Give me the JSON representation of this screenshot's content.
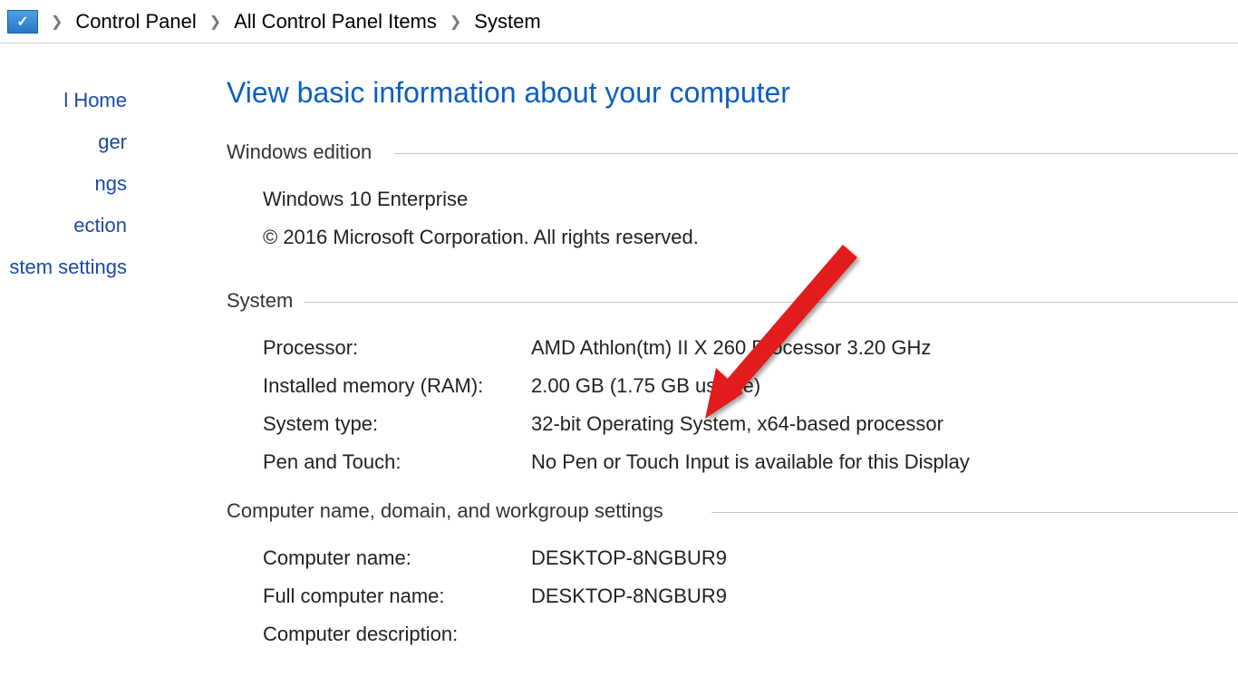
{
  "breadcrumb": {
    "items": [
      "Control Panel",
      "All Control Panel Items",
      "System"
    ]
  },
  "sidebar": {
    "items": [
      "l Home",
      "ger",
      "ngs",
      "ection",
      "stem settings"
    ]
  },
  "page": {
    "title": "View basic information about your computer"
  },
  "windows_edition": {
    "header": "Windows edition",
    "name": "Windows 10 Enterprise",
    "copyright": "© 2016 Microsoft Corporation. All rights reserved."
  },
  "system": {
    "header": "System",
    "rows": [
      {
        "label": "Processor:",
        "value": "AMD Athlon(tm) II X 260 Processor   3.20 GHz"
      },
      {
        "label": "Installed memory (RAM):",
        "value": "2.00 GB (1.75 GB usable)"
      },
      {
        "label": "System type:",
        "value": "32-bit Operating System, x64-based processor"
      },
      {
        "label": "Pen and Touch:",
        "value": "No Pen or Touch Input is available for this Display"
      }
    ]
  },
  "computer_name": {
    "header": "Computer name, domain, and workgroup settings",
    "rows": [
      {
        "label": "Computer name:",
        "value": "DESKTOP-8NGBUR9"
      },
      {
        "label": "Full computer name:",
        "value": "DESKTOP-8NGBUR9"
      },
      {
        "label": "Computer description:",
        "value": ""
      }
    ]
  }
}
